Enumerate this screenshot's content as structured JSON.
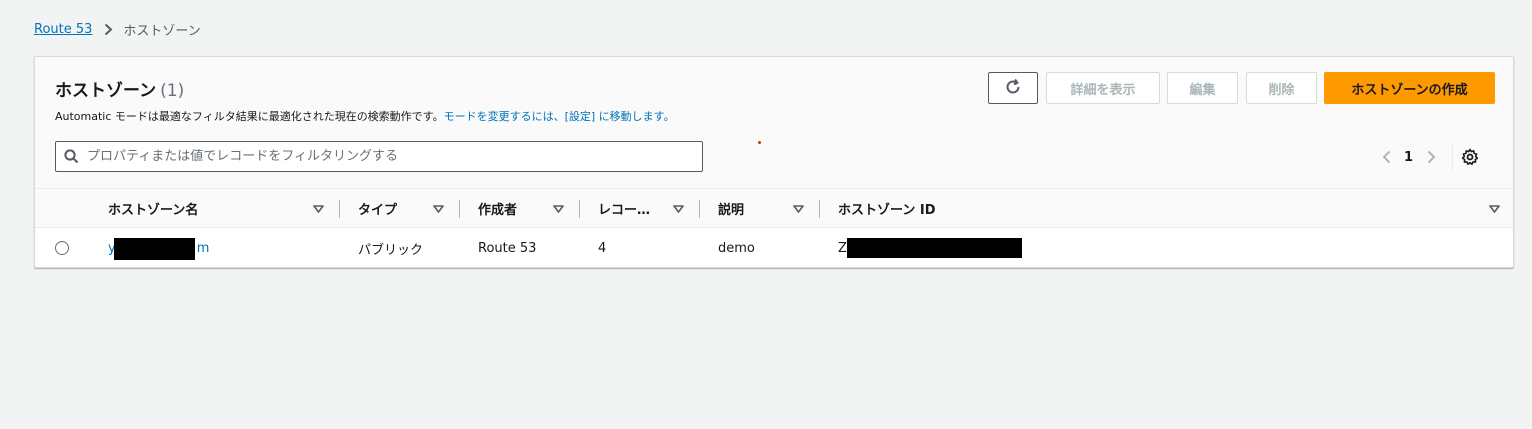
{
  "breadcrumb": {
    "root_label": "Route 53",
    "current_label": "ホストゾーン"
  },
  "header": {
    "title": "ホストゾーン",
    "count": "(1)",
    "description_text": "Automatic モードは最適なフィルタ結果に最適化された現在の検索動作です。",
    "description_link": "モードを変更するには、[設定] に移動します。"
  },
  "actions": {
    "details_label": "詳細を表示",
    "edit_label": "編集",
    "delete_label": "削除",
    "create_label": "ホストゾーンの作成"
  },
  "search": {
    "placeholder": "プロパティまたは値でレコードをフィルタリングする",
    "value": ""
  },
  "pagination": {
    "current_page": "1"
  },
  "table": {
    "columns": [
      "ホストゾーン名",
      "タイプ",
      "作成者",
      "レコー…",
      "説明",
      "ホストゾーン ID"
    ],
    "rows": [
      {
        "name_prefix": "y",
        "name_suffix": "m",
        "type": "パブリック",
        "created_by": "Route 53",
        "record_count": "4",
        "description": "demo",
        "id_prefix": "Z"
      }
    ]
  },
  "colors": {
    "primary_button": "#ff9900",
    "link": "#0073bb",
    "background": "#f2f3f3"
  }
}
